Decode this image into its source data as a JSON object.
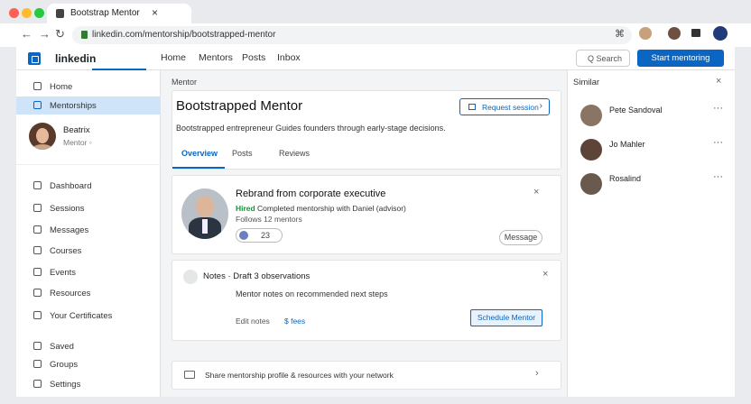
{
  "browser": {
    "tab_title": "Bootstrap Mentor",
    "tab_close": "×",
    "url": "linkedin.com/mentorship/bootstrapped-mentor",
    "back": "←",
    "forward": "→",
    "reload": "↻",
    "ext_icon": "⌘"
  },
  "topnav": {
    "brand": "linkedin",
    "menu": [
      "Home",
      "Mentors",
      "Posts",
      "Inbox"
    ],
    "search_placeholder": "Q Search",
    "cta": "Start mentoring"
  },
  "sidebar": {
    "items_top": [
      {
        "label": "Home",
        "icon": "home-icon"
      },
      {
        "label": "Mentorships",
        "icon": "mentor-icon",
        "active": true
      }
    ],
    "profile_name": "Beatrix",
    "profile_sub": "Mentor ◦",
    "items": [
      {
        "label": "Dashboard",
        "icon": "dashboard-icon"
      },
      {
        "label": "Sessions",
        "icon": "calendar-icon"
      },
      {
        "label": "Messages",
        "icon": "message-icon"
      },
      {
        "label": "Courses",
        "icon": "book-icon"
      },
      {
        "label": "Events",
        "icon": "event-icon"
      },
      {
        "label": "Resources",
        "icon": "resource-icon"
      },
      {
        "label": "Your Certificates",
        "icon": "certificate-icon"
      },
      {
        "label": "Saved",
        "icon": "bookmark-icon"
      },
      {
        "label": "Groups",
        "icon": "group-icon"
      },
      {
        "label": "Settings",
        "icon": "gear-icon"
      }
    ]
  },
  "main": {
    "section_label": "Mentor",
    "title": "Bootstrapped Mentor",
    "request_button": "Request session",
    "description": "Bootstrapped entrepreneur Guides founders through early-stage decisions.",
    "tabs": [
      "Overview",
      "Posts",
      "Reviews"
    ],
    "post": {
      "title": "Rebrand from corporate executive",
      "status": "Hired",
      "status_detail": "Completed mentorship with Daniel (advisor)",
      "meta": "Follows 12 mentors",
      "chip": "23",
      "action": "Message"
    },
    "note": {
      "heading": "Notes · Draft 3 observations",
      "body": "Mentor notes on recommended next steps",
      "link1": "Edit notes",
      "link2": "$ fees",
      "action": "Schedule Mentor"
    },
    "footer_row": "Share mentorship profile & resources with your network"
  },
  "right": {
    "title": "Similar",
    "close": "×",
    "people": [
      {
        "name": "Pete Sandoval",
        "more": "···"
      },
      {
        "name": "Jo Mahler",
        "more": "···"
      },
      {
        "name": "Rosalind",
        "more": "···"
      }
    ]
  },
  "colors": {
    "accent": "#0a66c2",
    "success": "#1a8f3c"
  }
}
